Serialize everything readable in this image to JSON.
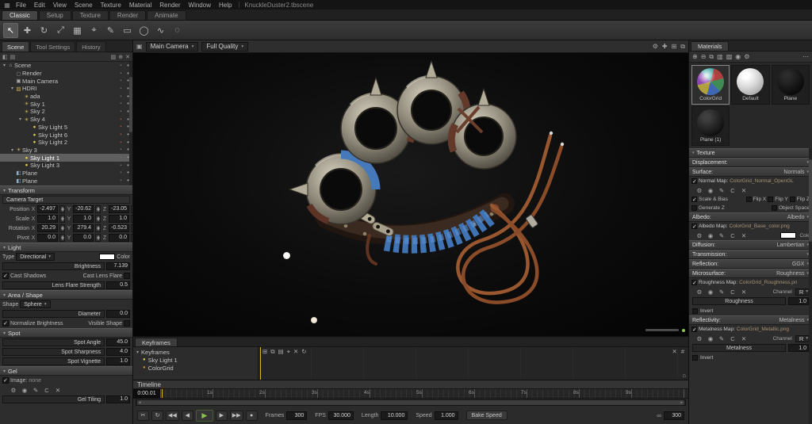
{
  "icons": {
    "app": "▦",
    "check": "✓",
    "caret": "▾",
    "caret_r": "▸",
    "minus": "−",
    "sun": "☀",
    "bulb": "●",
    "camera": "▣",
    "folder": "▨",
    "mesh": "◧",
    "monitor": "▢",
    "home": "⌂",
    "lock": "▪",
    "eye": "●",
    "gear": "⚙",
    "zoom": "◉",
    "edit": "✎",
    "clear": "C",
    "remove": "✕",
    "hash": "#",
    "link": "∞",
    "move": "✚",
    "split": "⊞",
    "expand": "⧉",
    "filter": "◧",
    "list": "▤",
    "newfolder": "▨",
    "add": "⊕",
    "trash": "✕",
    "grip_l": "◂",
    "grip_r": "▸"
  },
  "menubar": {
    "items": [
      "File",
      "Edit",
      "View",
      "Scene",
      "Texture",
      "Material",
      "Render",
      "Window",
      "Help"
    ],
    "title": "KnuckleDuster2.tbscene"
  },
  "mode_tabs": {
    "items": [
      "Classic",
      "Setup",
      "Texture",
      "Render",
      "Animate"
    ]
  },
  "toolbar": {
    "tools": [
      {
        "name": "select",
        "glyph": "↖"
      },
      {
        "name": "translate",
        "glyph": "✚"
      },
      {
        "name": "rotate",
        "glyph": "↻"
      },
      {
        "name": "scale",
        "glyph": "⤢"
      },
      {
        "name": "transform",
        "glyph": "▦"
      },
      {
        "name": "pivot",
        "glyph": "⌖"
      },
      {
        "name": "pen",
        "glyph": "✎"
      },
      {
        "name": "marquee-rect",
        "glyph": "▭"
      },
      {
        "name": "marquee-ellipse",
        "glyph": "◯"
      },
      {
        "name": "lasso",
        "glyph": "∿"
      },
      {
        "name": "paint",
        "glyph": "◌"
      }
    ]
  },
  "scene_panel": {
    "tabs": [
      "Scene",
      "Tool Settings",
      "History"
    ],
    "tree": [
      {
        "label": "Scene"
      },
      {
        "label": "Render"
      },
      {
        "label": "Main Camera"
      },
      {
        "label": "HDRI"
      },
      {
        "label": "ada"
      },
      {
        "label": "Sky 1"
      },
      {
        "label": "Sky 2"
      },
      {
        "label": "Sky 4"
      },
      {
        "label": "Sky Light 5"
      },
      {
        "label": "Sky Light 6"
      },
      {
        "label": "Sky Light 2"
      },
      {
        "label": "Sky 3"
      },
      {
        "label": "Sky Light 1"
      },
      {
        "label": "Sky Light 3"
      },
      {
        "label": "Plane"
      },
      {
        "label": "Plane"
      }
    ]
  },
  "transform": {
    "header": "Transform",
    "target": "Camera Target",
    "axis": [
      "X",
      "Y",
      "Z"
    ],
    "rows": [
      {
        "label": "Position",
        "x": "-2.497",
        "y": "-20.62",
        "z": "-23.05"
      },
      {
        "label": "Scale",
        "x": "1.0",
        "y": "1.0",
        "z": "1.0"
      },
      {
        "label": "Rotation",
        "x": "20.29",
        "y": "279.4",
        "z": "-0.523"
      },
      {
        "label": "Pivot",
        "x": "0.0",
        "y": "0.0",
        "z": "0.0"
      }
    ]
  },
  "light": {
    "header": "Light",
    "type_label": "Type",
    "type_value": "Directional",
    "color_label": "Color",
    "brightness_label": "Brightness",
    "brightness_value": "7.139",
    "cast_shadows": "Cast Shadows",
    "cast_lens_flare": "Cast Lens Flare",
    "flare_label": "Lens Flare Strength",
    "flare_value": "0.5"
  },
  "area": {
    "header": "Area / Shape",
    "shape_label": "Shape",
    "shape_value": "Sphere",
    "diameter_label": "Diameter",
    "diameter_value": "0.0",
    "normalize": "Normalize Brightness",
    "visible_shape": "Visible Shape"
  },
  "spot": {
    "header": "Spot",
    "rows": [
      {
        "label": "Spot Angle",
        "value": "45.0"
      },
      {
        "label": "Spot Sharpness",
        "value": "4.0"
      },
      {
        "label": "Spot Vignette",
        "value": "1.0"
      }
    ]
  },
  "gel": {
    "header": "Gel",
    "image_label": "Image:",
    "image_value": "none",
    "tiling_label": "Gel Tiling",
    "tiling_value": "1.0"
  },
  "viewport": {
    "camera": "Main Camera",
    "quality": "Full Quality"
  },
  "keyframes": {
    "tab": "Keyframes",
    "items": [
      {
        "label": "Keyframes"
      },
      {
        "label": "Sky Light 1"
      },
      {
        "label": "ColorGrid"
      }
    ],
    "icons": [
      {
        "name": "add-key",
        "glyph": "⊞"
      },
      {
        "name": "copy-key",
        "glyph": "⧉"
      },
      {
        "name": "paste-key",
        "glyph": "▤"
      },
      {
        "name": "key-target",
        "glyph": "⌖"
      },
      {
        "name": "delete-key",
        "glyph": "✕"
      },
      {
        "name": "refresh-keys",
        "glyph": "↻"
      }
    ]
  },
  "timeline": {
    "header": "Timeline",
    "current_time": "0:00.01",
    "ruler": [
      "1s",
      "2s",
      "3s",
      "4s",
      "5s",
      "6s",
      "7s",
      "8s",
      "9s"
    ],
    "frames_label": "Frames",
    "frames": "300",
    "fps_label": "FPS",
    "fps": "30.000",
    "length_label": "Length",
    "length": "10.000",
    "speed_label": "Speed",
    "speed": "1.000",
    "bake": "Bake Speed",
    "loop_frames": "300"
  },
  "controls": [
    {
      "name": "cut",
      "glyph": "✂"
    },
    {
      "name": "loop",
      "glyph": "↻"
    },
    {
      "name": "jump-start",
      "glyph": "◀◀"
    },
    {
      "name": "step-back",
      "glyph": "◀"
    },
    {
      "name": "play",
      "glyph": "▶"
    },
    {
      "name": "step-forward",
      "glyph": "▶"
    },
    {
      "name": "jump-end",
      "glyph": "▶▶"
    },
    {
      "name": "record",
      "glyph": "●"
    }
  ],
  "materials": {
    "header": "Materials",
    "toolbar": [
      {
        "name": "new-material",
        "glyph": "⊕"
      },
      {
        "name": "delete-material",
        "glyph": "⊖"
      },
      {
        "name": "duplicate-material",
        "glyph": "⧉"
      },
      {
        "name": "material-library",
        "glyph": "▥"
      },
      {
        "name": "material-folder",
        "glyph": "▨"
      },
      {
        "name": "material-search",
        "glyph": "◉"
      },
      {
        "name": "material-settings",
        "glyph": "⚙"
      },
      {
        "name": "material-more",
        "glyph": "⋯"
      }
    ],
    "items": [
      {
        "name": "ColorGrid"
      },
      {
        "name": "Default"
      },
      {
        "name": "Plane"
      },
      {
        "name": "Plane (1)"
      }
    ]
  },
  "slot_icons": [
    {
      "name": "gear",
      "glyph": "⚙"
    },
    {
      "name": "zoom",
      "glyph": "◉"
    },
    {
      "name": "edit",
      "glyph": "✎"
    },
    {
      "name": "clear",
      "glyph": "C"
    },
    {
      "name": "remove",
      "glyph": "✕"
    }
  ],
  "props": {
    "texture_header": "Texture",
    "displacement_label": "Displacement:",
    "surface_label": "Surface:",
    "surface_value": "Normals",
    "normal_map_label": "Normal Map:",
    "normal_map_value": "ColorGrid_Normal_OpenGL",
    "scale_bias": "Scale & Bias",
    "flip_x": "Flip X",
    "flip_y": "Flip Y",
    "flip_z": "Flip Z",
    "generate_z": "Generate Z",
    "object_space": "Object Space",
    "albedo_label": "Albedo:",
    "albedo_value": "Albedo",
    "albedo_map_label": "Albedo Map:",
    "albedo_map_value": "ColorGrid_Base_color.png",
    "color_label": "Color",
    "diffusion_label": "Diffusion:",
    "diffusion_value": "Lambertian",
    "transmission_label": "Transmission:",
    "reflection_label": "Reflection:",
    "reflection_value": "GGX",
    "micro_label": "Microsurface:",
    "micro_value": "Roughness",
    "rough_map_label": "Roughness Map:",
    "rough_map_value": "ColorGrid_Roughness.pn",
    "channel_label": "Channel",
    "rough_channel": "R",
    "metal_channel": "R",
    "rough_slider": "Roughness",
    "rough_value": "1.0",
    "invert": "Invert",
    "refl_label": "Reflectivity:",
    "refl_value": "Metalness",
    "metal_map_label": "Metalness Map:",
    "metal_map_value": "ColorGrid_Metallic.png",
    "metal_slider": "Metalness",
    "metal_value": "1.0"
  }
}
